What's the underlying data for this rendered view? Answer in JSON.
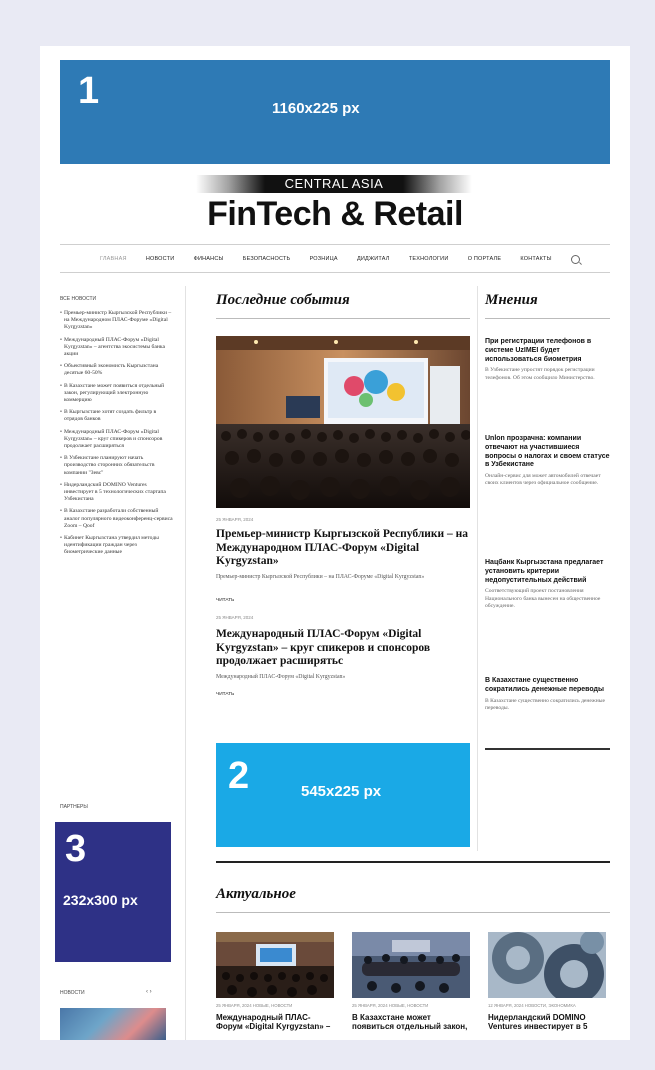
{
  "ads": {
    "ad1": {
      "number": "1",
      "size": "1160x225 px"
    },
    "ad2": {
      "number": "2",
      "size": "545x225 px"
    },
    "ad3": {
      "number": "3",
      "size": "232x300 px"
    }
  },
  "brand": {
    "top": "CENTRAL ASIA",
    "main": "FinTech & Retail"
  },
  "nav": {
    "items": [
      "Главная",
      "Новости",
      "Финансы",
      "Безопасность",
      "Розница",
      "Диджитал",
      "Технологии",
      "О портале",
      "Контакты"
    ],
    "search_icon": "search-icon"
  },
  "left": {
    "news_heading": "Все новости",
    "news": [
      "Премьер-министр Кыргызской Республики – на Международном ПЛАС-Форуме «Digital Kyrgyzstan»",
      "Международный ПЛАС-Форум «Digital Kyrgyzstan» – агентства экосистемы банка акции",
      "Объективный экономисть Кыргызстана десятые 60-50%",
      "В Казахстане может появиться отдельный закон, регулирующий электронную коммерцию",
      "В Кыргызстане хотят создать фильтр в отрядов банков",
      "Международный ПЛАС-Форум «Digital Kyrgyzstan» – круг спикеров и спонсоров продолжает расширяться",
      "В Узбекистане планируют начать производство сторонних обязательств компании \"Зевс\"",
      "Нидерландский DOMINO Ventures инвестирует в 5 технологических стартапа Узбекистана",
      "В Казахстане разработали собственный аналог популярного видеоконференц-сервиса Zoom – Qoof",
      "Кабинет Кыргызстана утвердил методы идентификации граждан через биометрические данные"
    ],
    "partners_heading": "Партнеры",
    "bottom_heading": "Новости",
    "pager": "‹  ›"
  },
  "main": {
    "latest_title": "Последние события",
    "article1": {
      "date": "25 января, 2024",
      "title": "Премьер-министр Кыргызской Республики – на Международном ПЛАС-Форум «Digital Kyrgyzstan»",
      "lead": "Премьер-министр Кыргызской Республики – на ПЛАС-Форуме «Digital Kyrgyzstan»",
      "more": "Читать"
    },
    "article2": {
      "date": "25 января, 2024",
      "title": "Международный ПЛАС-Форум «Digital Kyrgyzstan» – круг спикеров и спонсоров продолжает расширятьс",
      "lead": "Международный ПЛАС-Форум «Digital Kyrgyzstan»",
      "more": "Читать"
    },
    "actual_title": "Актуальное",
    "actual": [
      {
        "meta": "25 января, 2024   Новые, новости",
        "title": "Международный ПЛАС-Форум «Digital Kyrgyzstan» –"
      },
      {
        "meta": "25 января, 2024   Новые, новости",
        "title": "В Казахстане может появиться отдельный закон,"
      },
      {
        "meta": "12 января, 2024   Новости, Экономика",
        "title": "Нидерландский DOMINO Ventures инвестирует в 5"
      }
    ]
  },
  "opinions": {
    "title": "Мнения",
    "items": [
      {
        "title": "При регистрации телефонов в системе UzIMEI будет использоваться биометрия",
        "text": "В Узбекистане упростят порядок регистрации телефонов. Об этом сообщило Министерство."
      },
      {
        "title": "Unlon прозрачна: компании отвечают на участившиеся вопросы о налогах и своем статусе в Узбекистане",
        "text": "Онлайн-сервис для может автомобилей отвечает своих клиентов через официальное сообщение."
      },
      {
        "title": "Нацбанк Кыргызстана предлагает установить критерии недопустительных действий",
        "text": "Соответствующий проект постановления Национального банка вынесен на общественное обсуждение."
      },
      {
        "title": "В Казахстане существенно сократились денежные переводы",
        "text": "В Казахстане существенно сократились денежные переводы."
      }
    ]
  },
  "colors": {
    "ad1": "#2e7ab5",
    "ad2": "#1aa9e6",
    "ad3": "#2e3186",
    "background": "#e9eaf4"
  }
}
